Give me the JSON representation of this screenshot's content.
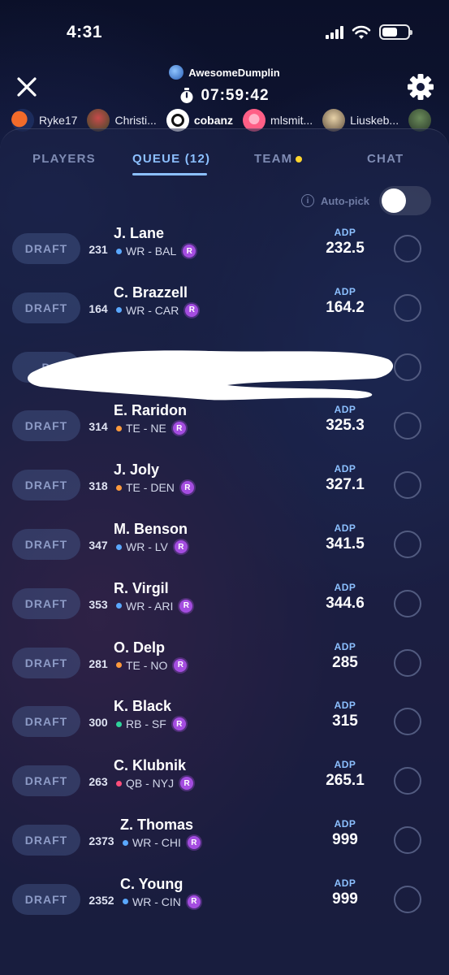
{
  "status_bar": {
    "time": "4:31"
  },
  "header": {
    "username": "AwesomeDumplin",
    "timer": "07:59:42"
  },
  "drafters": [
    {
      "name": "Ryke17",
      "active": false,
      "color": "#f26b2a"
    },
    {
      "name": "Christi...",
      "active": false,
      "color": "#7a2a2a"
    },
    {
      "name": "cobanz",
      "active": true,
      "color": "#ffffff"
    },
    {
      "name": "mlsmit...",
      "active": false,
      "color": "#ff5f86"
    },
    {
      "name": "Liuskeb...",
      "active": false,
      "color": "#b9a37a"
    }
  ],
  "tabs": {
    "players": "PLAYERS",
    "queue": "QUEUE (12)",
    "team": "TEAM",
    "chat": "CHAT"
  },
  "autopick": {
    "label": "Auto-pick",
    "enabled": true
  },
  "queue": [
    {
      "draft_label": "DRAFT",
      "rank": "231",
      "name": "J. Lane",
      "pos": "WR",
      "team": "BAL",
      "meta": "WR - BAL",
      "pos_color": "#5aa8ff",
      "adp_label": "ADP",
      "adp": "232.5",
      "rookie": "R"
    },
    {
      "draft_label": "DRAFT",
      "rank": "164",
      "name": "C. Brazzell",
      "pos": "WR",
      "team": "CAR",
      "meta": "WR - CAR",
      "pos_color": "#5aa8ff",
      "adp_label": "ADP",
      "adp": "164.2",
      "rookie": "R"
    },
    {
      "draft_label": "D",
      "hidden": true
    },
    {
      "draft_label": "DRAFT",
      "rank": "314",
      "name": "E. Raridon",
      "pos": "TE",
      "team": "NE",
      "meta": "TE - NE",
      "pos_color": "#ff9a3c",
      "adp_label": "ADP",
      "adp": "325.3",
      "rookie": "R"
    },
    {
      "draft_label": "DRAFT",
      "rank": "318",
      "name": "J. Joly",
      "pos": "TE",
      "team": "DEN",
      "meta": "TE - DEN",
      "pos_color": "#ff9a3c",
      "adp_label": "ADP",
      "adp": "327.1",
      "rookie": "R"
    },
    {
      "draft_label": "DRAFT",
      "rank": "347",
      "name": "M. Benson",
      "pos": "WR",
      "team": "LV",
      "meta": "WR - LV",
      "pos_color": "#5aa8ff",
      "adp_label": "ADP",
      "adp": "341.5",
      "rookie": "R"
    },
    {
      "draft_label": "DRAFT",
      "rank": "353",
      "name": "R. Virgil",
      "pos": "WR",
      "team": "ARI",
      "meta": "WR - ARI",
      "pos_color": "#5aa8ff",
      "adp_label": "ADP",
      "adp": "344.6",
      "rookie": "R"
    },
    {
      "draft_label": "DRAFT",
      "rank": "281",
      "name": "O. Delp",
      "pos": "TE",
      "team": "NO",
      "meta": "TE - NO",
      "pos_color": "#ff9a3c",
      "adp_label": "ADP",
      "adp": "285",
      "rookie": "R"
    },
    {
      "draft_label": "DRAFT",
      "rank": "300",
      "name": "K. Black",
      "pos": "RB",
      "team": "SF",
      "meta": "RB - SF",
      "pos_color": "#2fd39a",
      "adp_label": "ADP",
      "adp": "315",
      "rookie": "R"
    },
    {
      "draft_label": "DRAFT",
      "rank": "263",
      "name": "C. Klubnik",
      "pos": "QB",
      "team": "NYJ",
      "meta": "QB - NYJ",
      "pos_color": "#ff4d7a",
      "adp_label": "ADP",
      "adp": "265.1",
      "rookie": "R"
    },
    {
      "draft_label": "DRAFT",
      "rank": "2373",
      "name": "Z. Thomas",
      "pos": "WR",
      "team": "CHI",
      "meta": "WR - CHI",
      "pos_color": "#5aa8ff",
      "adp_label": "ADP",
      "adp": "999",
      "rookie": "R"
    },
    {
      "draft_label": "DRAFT",
      "rank": "2352",
      "name": "C. Young",
      "pos": "WR",
      "team": "CIN",
      "meta": "WR - CIN",
      "pos_color": "#5aa8ff",
      "adp_label": "ADP",
      "adp": "999",
      "rookie": "R"
    }
  ]
}
